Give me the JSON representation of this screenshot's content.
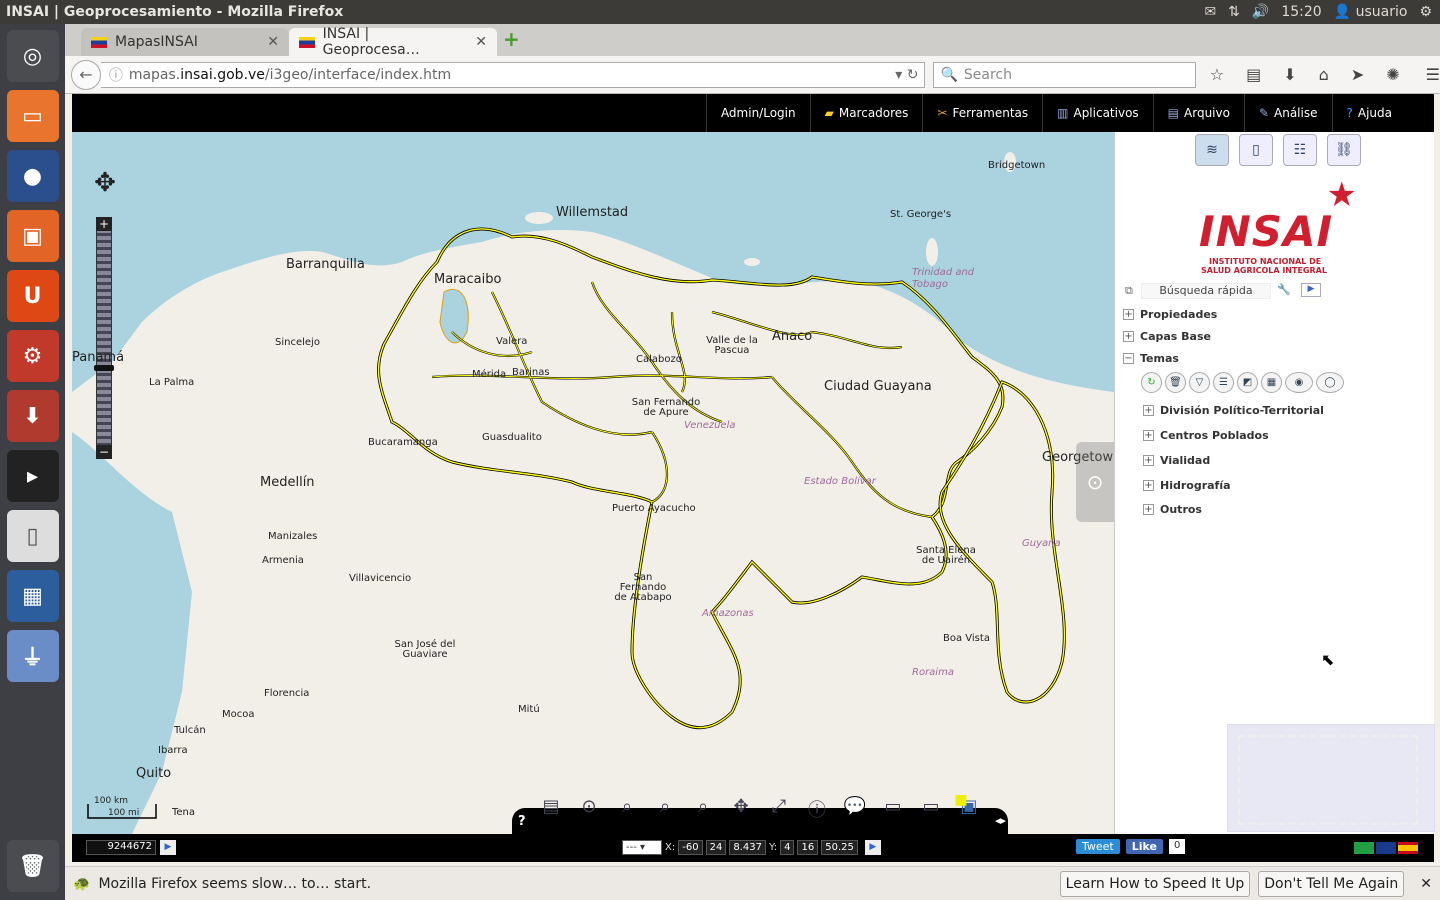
{
  "os": {
    "window_title": "INSAI | Geoprocesamiento - Mozilla Firefox",
    "time": "15:20",
    "user": "usuario"
  },
  "browser": {
    "tabs": [
      {
        "label": "MapasINSAI"
      },
      {
        "label": "INSAI | Geoprocesa…"
      }
    ],
    "url_prefix": "mapas.",
    "url_host": "insai.gob.ve",
    "url_path": "/i3geo/interface/index.htm",
    "search_placeholder": "Search"
  },
  "app_menu": [
    {
      "label": "Admin/Login"
    },
    {
      "label": "Marcadores"
    },
    {
      "label": "Ferramentas"
    },
    {
      "label": "Aplicativos"
    },
    {
      "label": "Arquivo"
    },
    {
      "label": "Análise"
    },
    {
      "label": "Ajuda"
    }
  ],
  "map": {
    "places": [
      {
        "name": "Willemstad"
      },
      {
        "name": "Barranquilla"
      },
      {
        "name": "Maracaibo"
      },
      {
        "name": "Bridgetown"
      },
      {
        "name": "St. George's"
      },
      {
        "name": "Trinidad and Tobago"
      },
      {
        "name": "Panamá"
      },
      {
        "name": "Anaco"
      },
      {
        "name": "Ciudad Guayana"
      },
      {
        "name": "Georgetown"
      },
      {
        "name": "Medellín"
      },
      {
        "name": "Bucaramanga"
      },
      {
        "name": "Guasdualito"
      },
      {
        "name": "Puerto Ayacucho"
      },
      {
        "name": "San Fernando de Apure"
      },
      {
        "name": "Calabozo"
      },
      {
        "name": "Valle de la Pascua"
      },
      {
        "name": "Barinas"
      },
      {
        "name": "Mérida"
      },
      {
        "name": "Valera"
      },
      {
        "name": "Sincelejo"
      },
      {
        "name": "La Palma"
      },
      {
        "name": "Manizales"
      },
      {
        "name": "Armenia"
      },
      {
        "name": "Villavicencio"
      },
      {
        "name": "San José del Guaviare"
      },
      {
        "name": "Florencia"
      },
      {
        "name": "Mocoa"
      },
      {
        "name": "Tulcán"
      },
      {
        "name": "Ibarra"
      },
      {
        "name": "Quito"
      },
      {
        "name": "Tena"
      },
      {
        "name": "Mitú"
      },
      {
        "name": "Santa Elena de Uairén"
      },
      {
        "name": "Boa Vista"
      },
      {
        "name": "Guyana"
      },
      {
        "name": "Venezuela"
      },
      {
        "name": "Estado Bolívar"
      },
      {
        "name": "Amazonas"
      },
      {
        "name": "San Fernando de Atabapo"
      },
      {
        "name": "Roraima"
      }
    ],
    "scale_km": "100 km",
    "scale_mi": "100 mi"
  },
  "panel": {
    "logo_text": "INSAI",
    "logo_subtitle_1": "INSTITUTO NACIONAL DE",
    "logo_subtitle_2": "SALUD AGRICOLA INTEGRAL",
    "quick_search_placeholder": "Búsqueda rápida",
    "tree": [
      {
        "label": "Propiedades"
      },
      {
        "label": "Capas Base"
      },
      {
        "label": "Temas"
      }
    ],
    "themes": [
      {
        "label": "División Político-Territorial"
      },
      {
        "label": "Centros Poblados"
      },
      {
        "label": "Vialidad"
      },
      {
        "label": "Hidrografía"
      },
      {
        "label": "Outros"
      }
    ]
  },
  "statusbar": {
    "scale_value": "9244672",
    "coord_select": "---",
    "x_label": "X:",
    "x_deg": "-60",
    "x_min": "24",
    "x_sec": "8.437",
    "y_label": "Y:",
    "y_deg": "4",
    "y_min": "16",
    "y_sec": "50.25",
    "tweet": "Tweet",
    "like": "Like",
    "like_count": "0"
  },
  "notification": {
    "message": "Mozilla Firefox seems slow… to… start.",
    "learn_btn": "Learn How to Speed It Up",
    "dismiss_btn": "Don't Tell Me Again"
  }
}
